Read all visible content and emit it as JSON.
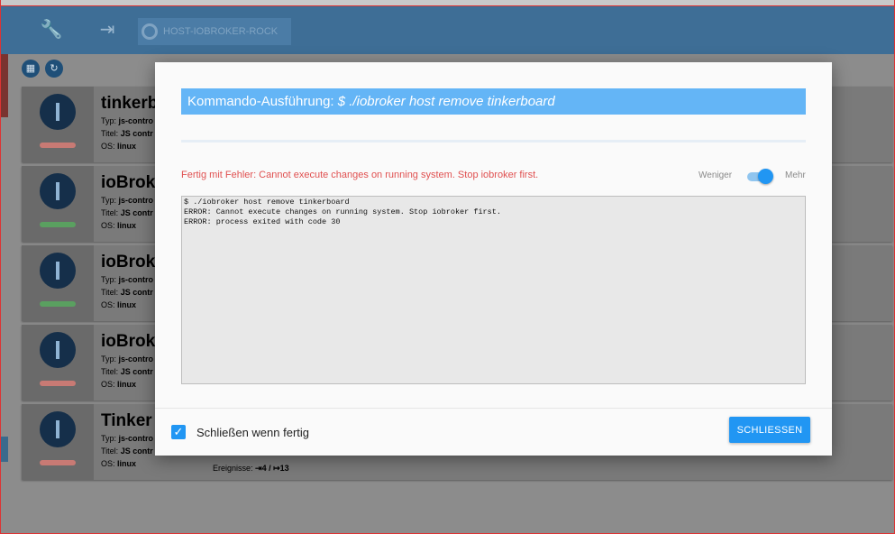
{
  "toolbar": {
    "wrench_icon": "wrench-icon",
    "logout_icon": "exit-icon",
    "host_chip": "HOST-IOBROKER-ROCK"
  },
  "cards": [
    {
      "name": "tinkerb",
      "typ": "js-contro",
      "titel": "JS contr",
      "os": "linux",
      "status": "#c87a74"
    },
    {
      "name": "ioBroke",
      "typ": "js-contro",
      "titel": "JS contr",
      "os": "linux",
      "status": "#5aa060"
    },
    {
      "name": "ioBrok",
      "typ": "js-contro",
      "titel": "JS contr",
      "os": "linux",
      "status": "#5aa060"
    },
    {
      "name": "ioBrok",
      "typ": "js-contro",
      "titel": "JS contr",
      "os": "linux",
      "status": "#c87a74"
    },
    {
      "name": "Tinker",
      "typ": "js-contro",
      "titel": "JS contr",
      "os": "linux",
      "status": "#c87a74",
      "events_label": "Ereignisse:",
      "events_value": "⇥4 / ↦13"
    }
  ],
  "labels": {
    "typ": "Typ:",
    "titel": "Titel:",
    "os": "OS:"
  },
  "dialog": {
    "title_prefix": "Kommando-Ausführung: ",
    "title_command": "$ ./iobroker host remove tinkerboard",
    "error_message": "Fertig mit Fehler: Cannot execute changes on running system. Stop iobroker first.",
    "toggle_less": "Weniger",
    "toggle_more": "Mehr",
    "toggle_on": true,
    "log_lines": [
      "$ ./iobroker host remove tinkerboard",
      "ERROR: Cannot execute changes on running system. Stop iobroker first.",
      "ERROR: process exited with code 30"
    ],
    "close_when_done_label": "Schließen wenn fertig",
    "close_when_done_checked": true,
    "close_button": "SCHLIESSEN"
  },
  "colors": {
    "accent": "#2196f3",
    "title_bar": "#64b5f6",
    "error": "#e05050"
  }
}
